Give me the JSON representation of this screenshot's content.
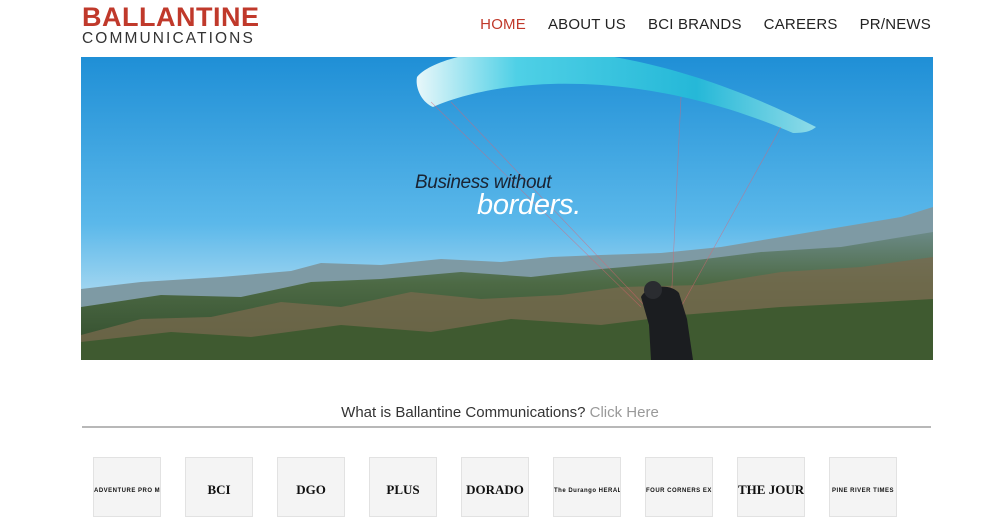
{
  "logo": {
    "line1": "BALLANTINE",
    "line2": "COMMUNICATIONS"
  },
  "nav": [
    {
      "label": "HOME",
      "active": true
    },
    {
      "label": "ABOUT US",
      "active": false
    },
    {
      "label": "BCI BRANDS",
      "active": false
    },
    {
      "label": "CAREERS",
      "active": false
    },
    {
      "label": "PR/NEWS",
      "active": false
    }
  ],
  "hero": {
    "line1": "Business without",
    "line2": "borders."
  },
  "intro": {
    "question": "What is Ballantine Communications?",
    "link": "Click Here"
  },
  "brands": [
    {
      "name": "ADVENTURE PRO MAGAZINE"
    },
    {
      "name": "BCI"
    },
    {
      "name": "DGO"
    },
    {
      "name": "PLUS"
    },
    {
      "name": "DORADO"
    },
    {
      "name": "The Durango HERALD"
    },
    {
      "name": "FOUR CORNERS EXPOS"
    },
    {
      "name": "THE JOURNAL"
    },
    {
      "name": "PINE RIVER TIMES"
    }
  ],
  "colors": {
    "accent": "#c0392b",
    "sky": "#3aa6e0",
    "canopy": "#2ec5e0"
  }
}
